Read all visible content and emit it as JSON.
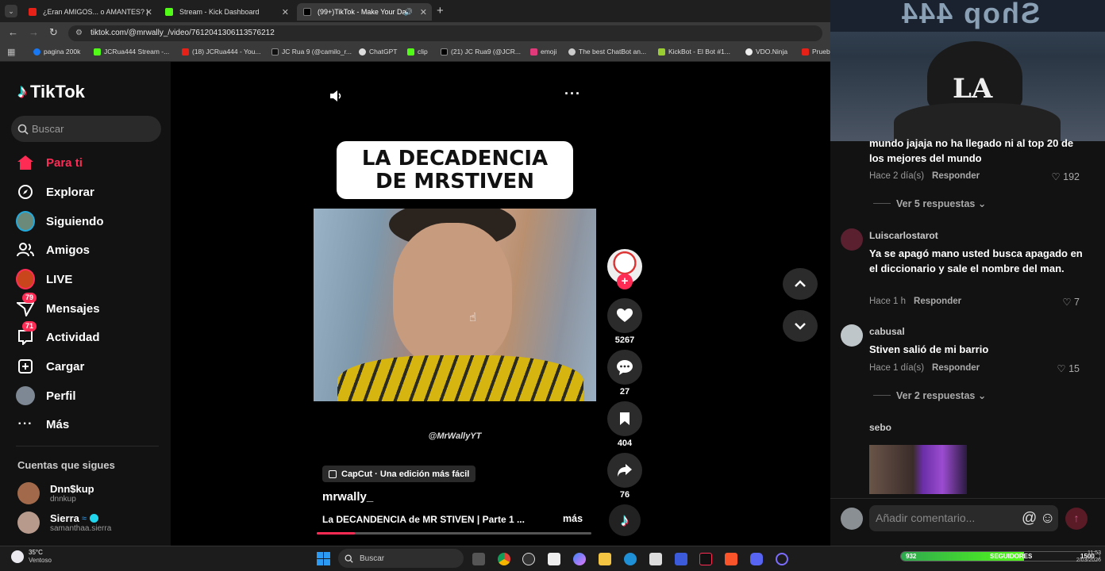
{
  "browser": {
    "tabs": [
      {
        "title": "¿Eran AMIGOS... o AMANTES? |"
      },
      {
        "title": "Stream - Kick Dashboard"
      },
      {
        "title": "(99+)TikTok - Make Your Da"
      }
    ],
    "url": "tiktok.com/@mrwally_/video/7612041306113576212",
    "bookmarks": [
      "pagina 200k",
      "JCRua444 Stream -...",
      "(18) JCRua444 - You...",
      "JC Rua 9 (@camilo_r...",
      "ChatGPT",
      "clip",
      "(21) JC Rua9 (@JCR...",
      "emoji",
      "The best ChatBot an...",
      "KickBot - El Bot #1...",
      "VDO.Ninja",
      "Prueb"
    ]
  },
  "sidebar": {
    "logo": "TikTok",
    "search_placeholder": "Buscar",
    "nav": [
      {
        "label": "Para ti"
      },
      {
        "label": "Explorar"
      },
      {
        "label": "Siguiendo"
      },
      {
        "label": "Amigos"
      },
      {
        "label": "LIVE"
      },
      {
        "label": "Mensajes",
        "badge": "79"
      },
      {
        "label": "Actividad",
        "badge": "71"
      },
      {
        "label": "Cargar"
      },
      {
        "label": "Perfil"
      },
      {
        "label": "Más"
      }
    ],
    "following_title": "Cuentas que sigues",
    "following": [
      {
        "name": "Dnn$kup",
        "handle": "dnnkup"
      },
      {
        "name": "Sierra",
        "handle": "samanthaa.sierra"
      }
    ]
  },
  "video": {
    "overlay_title": "LA DECADENCIA DE MRSTIVEN",
    "watermark": "@MrWallyYT",
    "capcut_label": "CapCut · Una edición más fácil",
    "author": "mrwally_",
    "caption": "La DECANDENCIA de MR STIVEN | Parte 1 ...",
    "more_label": "más",
    "likes": "5267",
    "comments": "27",
    "saves": "404",
    "shares": "76"
  },
  "webcam": {
    "sign": "Shop 444",
    "cap_logo": "LA"
  },
  "comments": {
    "items": [
      {
        "text": "mundo jajaja no ha llegado ni al top 20 de los mejores del mundo",
        "time": "Hace 2 día(s)",
        "reply": "Responder",
        "likes": "192",
        "replies_label": "Ver 5 respuestas"
      },
      {
        "user": "Luiscarlostarot",
        "text": "Ya se apagó mano usted busca apagado en el diccionario y sale el nombre del man.",
        "time": "Hace 1 h",
        "reply": "Responder",
        "likes": "7"
      },
      {
        "user": "cabusal",
        "text": "Stiven salió de mi barrio",
        "time": "Hace 1 día(s)",
        "reply": "Responder",
        "likes": "15",
        "replies_label": "Ver 2 respuestas"
      },
      {
        "user": "sebo"
      }
    ],
    "input_placeholder": "Añadir comentario..."
  },
  "taskbar": {
    "weather_temp": "35°C",
    "weather_desc": "Ventoso",
    "search_label": "Buscar",
    "followers_count": "932",
    "followers_label": "SEGUIDORES",
    "followers_goal": "1500",
    "time": "11:53",
    "date": "2/03/2026"
  },
  "colors": {
    "accent": "#fe2c55",
    "bg": "#121212",
    "stage": "#000000"
  }
}
